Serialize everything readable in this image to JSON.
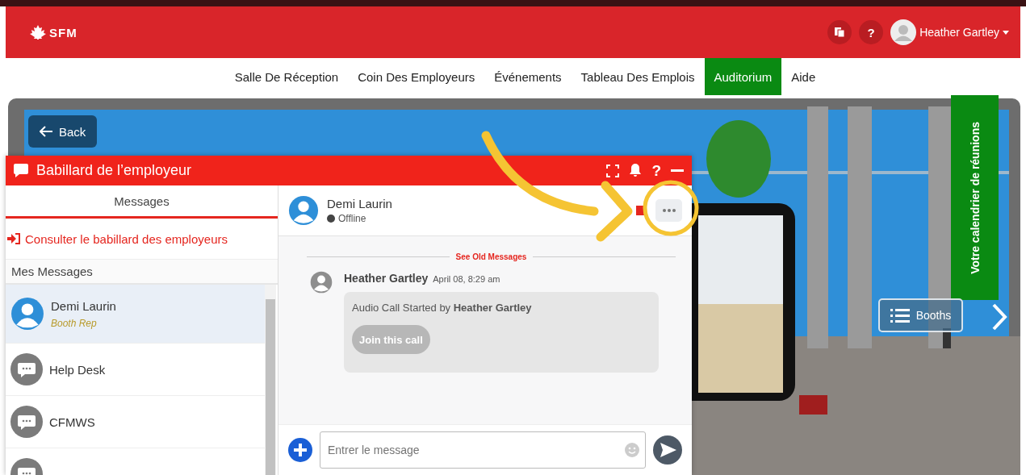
{
  "header": {
    "logo": "SFM",
    "help_glyph": "?",
    "user_name": "Heather Gartley"
  },
  "nav": [
    {
      "label": "Salle De Réception",
      "selected": false
    },
    {
      "label": "Coin Des Employeurs",
      "selected": false
    },
    {
      "label": "Événements",
      "selected": false
    },
    {
      "label": "Tableau Des Emplois",
      "selected": false
    },
    {
      "label": "Auditorium",
      "selected": true
    },
    {
      "label": "Aide",
      "selected": false
    }
  ],
  "back_button": "Back",
  "calendar_tab": "Votre calendrier de réunions",
  "booths_button": "Booths",
  "chat": {
    "title": "Babillard de l’employeur",
    "help_glyph": "?",
    "tabs": [
      {
        "label": "Messages",
        "selected": true
      }
    ],
    "board_link": "Consulter le babillard des employeurs",
    "section": "Mes Messages",
    "conversations": [
      {
        "kind": "person",
        "name": "Demi Laurin",
        "role": "Booth Rep",
        "selected": true
      },
      {
        "kind": "group",
        "name": "Help Desk",
        "selected": false
      },
      {
        "kind": "group",
        "name": "CFMWS",
        "selected": false
      },
      {
        "kind": "group",
        "selected": false
      }
    ],
    "contact": {
      "name": "Demi Laurin",
      "status": "Offline",
      "online": false
    },
    "old_messages": "See Old Messages",
    "messages": [
      {
        "author": "Heather Gartley",
        "time": "April 08, 8:29 am",
        "text": "Audio Call Started by **Heather Gartley**",
        "action": "Join this call"
      }
    ],
    "composer": {
      "placeholder": "Entrer le message"
    }
  }
}
